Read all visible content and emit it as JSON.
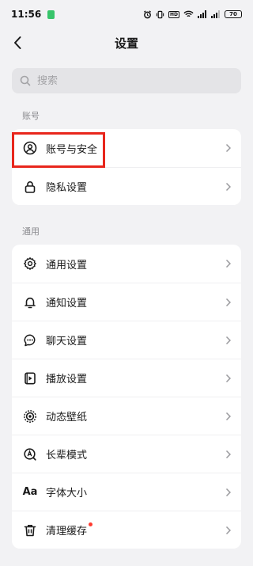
{
  "status_bar": {
    "time": "11:56",
    "hd_label": "HD",
    "battery": "70"
  },
  "header": {
    "title": "设置"
  },
  "search": {
    "placeholder": "搜索"
  },
  "sections": {
    "account": {
      "label": "账号",
      "items": [
        {
          "label": "账号与安全",
          "icon": "account-icon"
        },
        {
          "label": "隐私设置",
          "icon": "lock-icon"
        }
      ]
    },
    "general": {
      "label": "通用",
      "items": [
        {
          "label": "通用设置",
          "icon": "gear-icon"
        },
        {
          "label": "通知设置",
          "icon": "bell-icon"
        },
        {
          "label": "聊天设置",
          "icon": "chat-bubble-icon"
        },
        {
          "label": "播放设置",
          "icon": "play-settings-icon"
        },
        {
          "label": "动态壁纸",
          "icon": "wallpaper-icon"
        },
        {
          "label": "长辈模式",
          "icon": "elder-mode-icon"
        },
        {
          "label": "字体大小",
          "icon": "font-size-icon",
          "glyph": "Aa"
        },
        {
          "label": "清理缓存",
          "icon": "trash-icon",
          "badge": "red-dot"
        }
      ]
    }
  },
  "colors": {
    "highlight": "#e8261c",
    "badge": "#ff3b30",
    "background": "#f2f2f4"
  }
}
